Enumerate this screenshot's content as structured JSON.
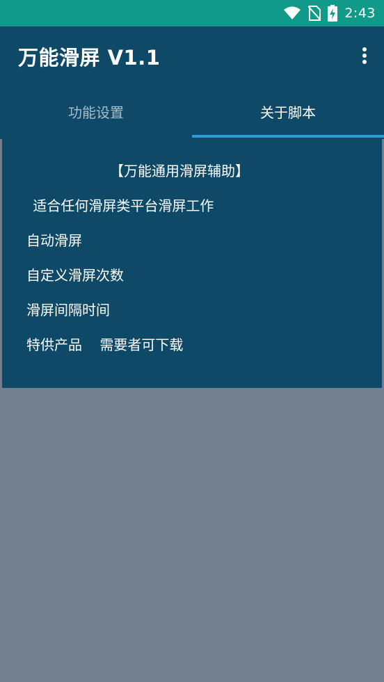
{
  "status_bar": {
    "time": "2:43",
    "icons": [
      "wifi-icon",
      "no-sim-icon",
      "battery-charging-icon"
    ]
  },
  "app_bar": {
    "title": "万能滑屏 V1.1",
    "menu_icon": "more-vert-icon"
  },
  "tabs": [
    {
      "label": "功能设置",
      "selected": false
    },
    {
      "label": "关于脚本",
      "selected": true
    }
  ],
  "about": {
    "heading": "【万能通用滑屏辅助】",
    "lines": [
      " 适合任何滑屏类平台滑屏工作",
      "自动滑屏",
      "自定义滑屏次数",
      "滑屏间隔时间",
      "特供产品    需要者可下载"
    ]
  },
  "colors": {
    "status_bar": "#0f9a8a",
    "primary": "#0e4a68",
    "tab_indicator": "#2c9bd8",
    "background": "#72808f",
    "inactive_tab_text": "#a9bccb"
  }
}
